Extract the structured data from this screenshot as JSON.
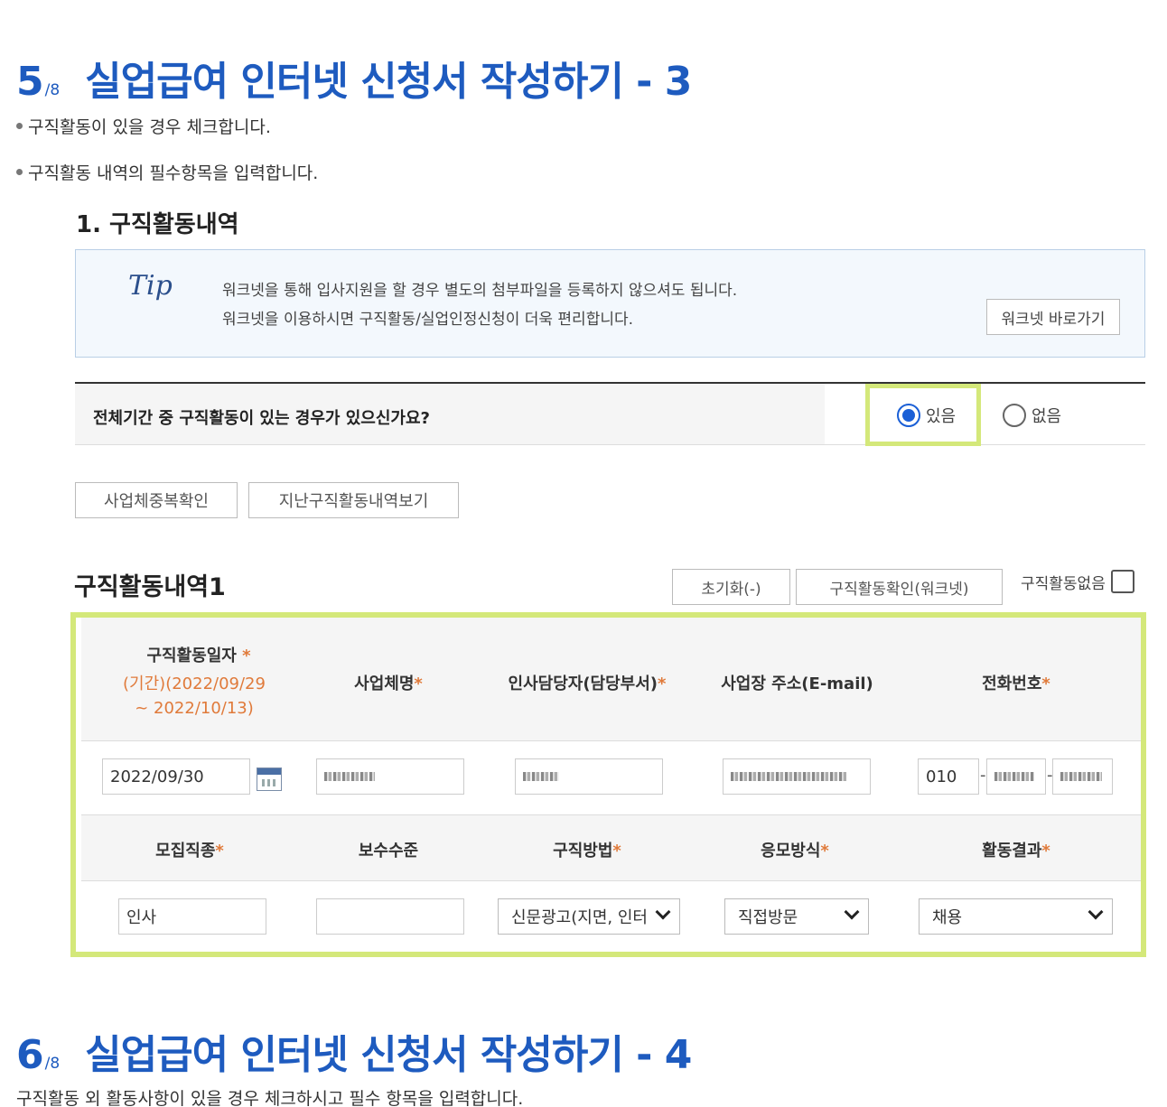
{
  "step5": {
    "num": "5",
    "total": "/8",
    "title": "실업급여 인터넷 신청서 작성하기 - 3"
  },
  "bullets": [
    "구직활동이 있을 경우 체크합니다.",
    "구직활동 내역의 필수항목을 입력합니다."
  ],
  "section_title": "1. 구직활동내역",
  "tip": {
    "mark": "Tip",
    "line1": "워크넷을 통해 입사지원을 할 경우 별도의 첨부파일을 등록하지 않으셔도 됩니다.",
    "line2": "워크넷을 이용하시면 구직활동/실업인정신청이 더욱 편리합니다.",
    "button": "워크넷 바로가기"
  },
  "question": {
    "label": "전체기간 중 구직활동이 있는 경우가 있으신가요?",
    "options": [
      "있음",
      "없음"
    ],
    "selected": "있음"
  },
  "buttons": {
    "dup_check": "사업체중복확인",
    "past_history": "지난구직활동내역보기"
  },
  "activity": {
    "title": "구직활동내역1",
    "reset": "초기화(-)",
    "confirm": "구직활동확인(워크넷)",
    "no_activity": "구직활동없음",
    "headers1": {
      "date": "구직활동일자",
      "date_period1": "(기간)(2022/09/29",
      "date_period2": "~ 2022/10/13)",
      "company": "사업체명",
      "manager": "인사담당자(담당부서)",
      "address": "사업장 주소(E-mail)",
      "phone": "전화번호"
    },
    "values1": {
      "date": "2022/09/30",
      "phone1": "010"
    },
    "headers2": {
      "job": "모집직종",
      "salary": "보수수준",
      "method": "구직방법",
      "apply": "응모방식",
      "result": "활동결과"
    },
    "values2": {
      "job": "인사",
      "salary": "",
      "method": "신문광고(지면, 인터",
      "apply": "직접방문",
      "result": "채용"
    },
    "required_mark": "*"
  },
  "step6": {
    "num": "6",
    "total": "/8",
    "title": "실업급여 인터넷 신청서 작성하기 - 4"
  },
  "step6_text": "구직활동 외 활동사항이 있을 경우 체크하시고 필수 항목을 입력합니다.",
  "colors": {
    "accent_blue": "#1e5bbf",
    "highlight": "#d4e87a",
    "required": "#e07a3a"
  }
}
